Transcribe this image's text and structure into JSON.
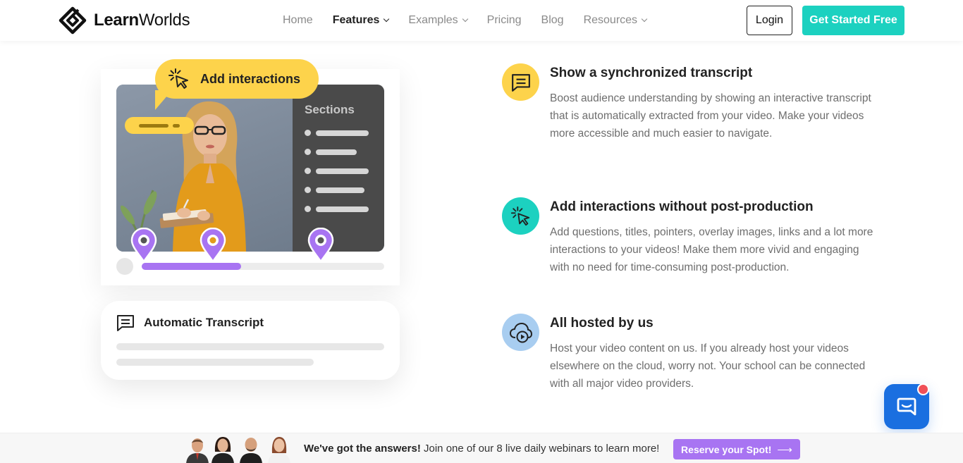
{
  "brand": {
    "name_bold": "Learn",
    "name_regular": "Worlds",
    "logo_icon": "learnworlds-logo-icon"
  },
  "nav": {
    "items": [
      {
        "label": "Home",
        "active": false,
        "dropdown": false
      },
      {
        "label": "Features",
        "active": true,
        "dropdown": true
      },
      {
        "label": "Examples",
        "active": false,
        "dropdown": true
      },
      {
        "label": "Pricing",
        "active": false,
        "dropdown": false
      },
      {
        "label": "Blog",
        "active": false,
        "dropdown": false
      },
      {
        "label": "Resources",
        "active": false,
        "dropdown": true
      }
    ],
    "login_label": "Login",
    "cta_label": "Get Started Free"
  },
  "visual": {
    "bubble_label": "Add interactions",
    "sections_title": "Sections",
    "progress_fraction": 0.41,
    "transcript_title": "Automatic Transcript"
  },
  "features": [
    {
      "icon": "transcript-icon",
      "icon_color": "#fdd34b",
      "title": "Show a synchronized transcript",
      "description": "Boost audience understanding by showing an interactive transcript that is automatically extracted from your video. Make your videos more accessible and much easier to navigate."
    },
    {
      "icon": "cursor-click-icon",
      "icon_color": "#1cd1c0",
      "title": "Add interactions without post-production",
      "description": "Add questions, titles, pointers, overlay images, links and a lot more interactions to your videos! Make them more vivid and engaging with no need for time-consuming post-production."
    },
    {
      "icon": "cloud-video-icon",
      "icon_color": "#a8cdf0",
      "title": "All hosted by us",
      "description": "Host your video content on us. If you already host your videos elsewhere on the cloud, worry not. Your school can be connected with all major video providers."
    }
  ],
  "banner": {
    "lead": "We've got the answers!",
    "text": " Join one of our 8 live daily webinars to learn more!",
    "cta_label": "Reserve your Spot!",
    "cta_arrow": "⟶"
  },
  "colors": {
    "accent_teal": "#1cd1c0",
    "accent_purple": "#a874f2",
    "accent_yellow": "#fdd34b",
    "chat_blue": "#1a6fe0"
  }
}
